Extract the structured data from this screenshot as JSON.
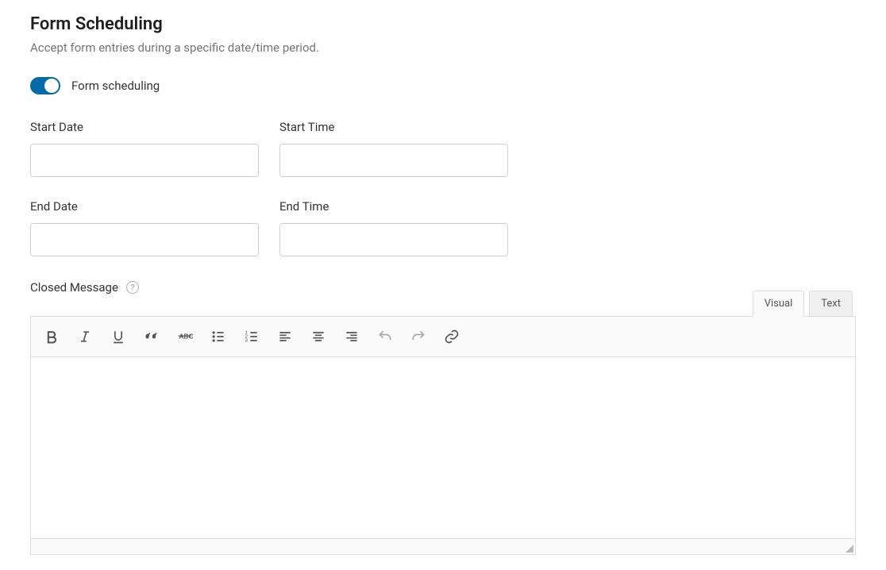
{
  "header": {
    "title": "Form Scheduling",
    "subtitle": "Accept form entries during a specific date/time period."
  },
  "toggle": {
    "label": "Form scheduling",
    "on": true
  },
  "fields": {
    "start_date": {
      "label": "Start Date",
      "value": ""
    },
    "start_time": {
      "label": "Start Time",
      "value": ""
    },
    "end_date": {
      "label": "End Date",
      "value": ""
    },
    "end_time": {
      "label": "End Time",
      "value": ""
    }
  },
  "closed_message": {
    "label": "Closed Message"
  },
  "tabs": {
    "visual": "Visual",
    "text": "Text",
    "active": "visual"
  },
  "editor": {
    "content": ""
  }
}
